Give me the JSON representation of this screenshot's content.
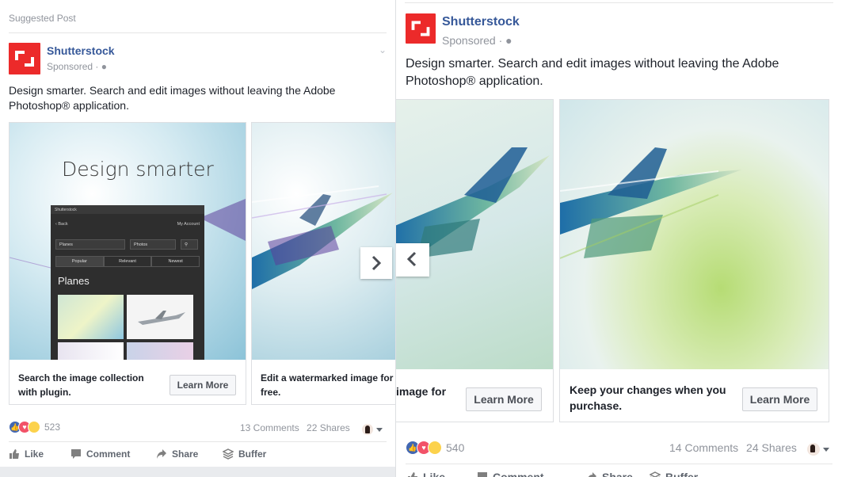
{
  "left_post": {
    "suggested_label": "Suggested Post",
    "page_name": "Shutterstock",
    "sponsored": "Sponsored · ",
    "caption_line1": "Design smarter. Search and edit images without leaving the Adobe",
    "caption_line2": "Photoshop® application.",
    "card1": {
      "image_title": "Design smarter",
      "plugin": {
        "app_name": "Shutterstock",
        "back": "Back",
        "my_account": "My Account",
        "search_value": "Planes",
        "filter_value": "Photos",
        "tabs": [
          "Popular",
          "Relevant",
          "Newest"
        ],
        "heading": "Planes"
      },
      "text_line1": "Search the image collection",
      "text_line2": "with plugin.",
      "cta": "Learn More"
    },
    "card2": {
      "text_line1": "Edit a watermarked image for",
      "text_line2": "free."
    },
    "reaction_count": "523",
    "comments": "13 Comments",
    "shares": "22 Shares",
    "actions": [
      "Like",
      "Comment",
      "Share",
      "Buffer"
    ]
  },
  "right_post": {
    "page_name": "Shutterstock",
    "sponsored": "Sponsored · ",
    "caption_line1": "Design smarter. Search and edit images without leaving the Adobe",
    "caption_line2": "Photoshop® application.",
    "card_prev": {
      "text_line1": "image for",
      "cta": "Learn More"
    },
    "card_current": {
      "text_line1": "Keep your changes when you",
      "text_line2": "purchase.",
      "cta": "Learn More"
    },
    "reaction_count": "540",
    "comments": "14 Comments",
    "shares": "24 Shares",
    "actions": [
      "Like",
      "Comment",
      "Share",
      "Buffer"
    ]
  },
  "colors": {
    "brand_red": "#ec2a2a",
    "link_blue": "#365899",
    "like_blue": "#4267b2",
    "love_red": "#f25268",
    "haha_yellow": "#fcd24c"
  },
  "icons": [
    "globe-icon",
    "chevron-down-icon",
    "chevron-right-icon",
    "chevron-left-icon",
    "like-icon",
    "comment-icon",
    "share-icon",
    "buffer-icon"
  ]
}
